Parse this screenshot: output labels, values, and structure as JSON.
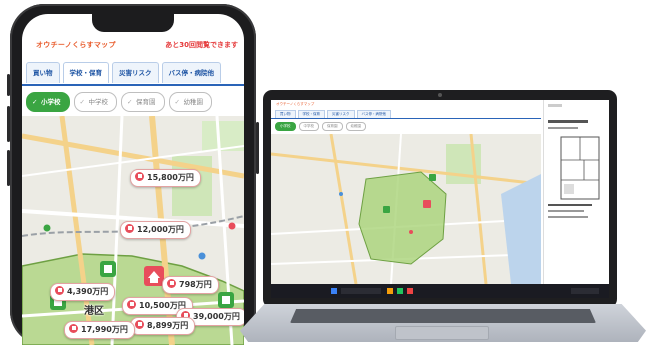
{
  "phone": {
    "app_logo": "オウチーノくらすマップ",
    "notice": "あと30回閲覧できます",
    "tabs": [
      {
        "label": "買い物",
        "active": false
      },
      {
        "label": "学校・保育",
        "active": true
      },
      {
        "label": "災害リスク",
        "active": false
      },
      {
        "label": "バス停・病院他",
        "active": false
      }
    ],
    "filters": [
      {
        "label": "小学校",
        "checked": true
      },
      {
        "label": "中学校",
        "checked": false
      },
      {
        "label": "保育園",
        "checked": false
      },
      {
        "label": "幼稚園",
        "checked": false
      }
    ],
    "map": {
      "area_label": "港区",
      "listings": [
        {
          "price": "15,800万円"
        },
        {
          "price": "12,000万円"
        },
        {
          "price": "4,390万円"
        },
        {
          "price": "798万円"
        },
        {
          "price": "10,500万円"
        },
        {
          "price": "39,000万円"
        },
        {
          "price": "8,899万円"
        },
        {
          "price": "17,990万円"
        }
      ]
    }
  },
  "laptop": {
    "app_logo": "オウチーノくらすマップ",
    "tabs": [
      "買い物",
      "学校・保育",
      "災害リスク",
      "バス停・病院他"
    ],
    "filters": [
      {
        "label": "小学校",
        "checked": true
      },
      {
        "label": "中学校",
        "checked": false
      },
      {
        "label": "保育園",
        "checked": false
      },
      {
        "label": "幼稚園",
        "checked": false
      }
    ]
  },
  "colors": {
    "brand_orange": "#e85a2a",
    "notice_red": "#e5393a",
    "tab_blue": "#1f55a4",
    "filter_green": "#3aa542",
    "school_zone_green": "#a9d378",
    "pin_red": "#e84d5b",
    "map_bg": "#ecebe4"
  }
}
